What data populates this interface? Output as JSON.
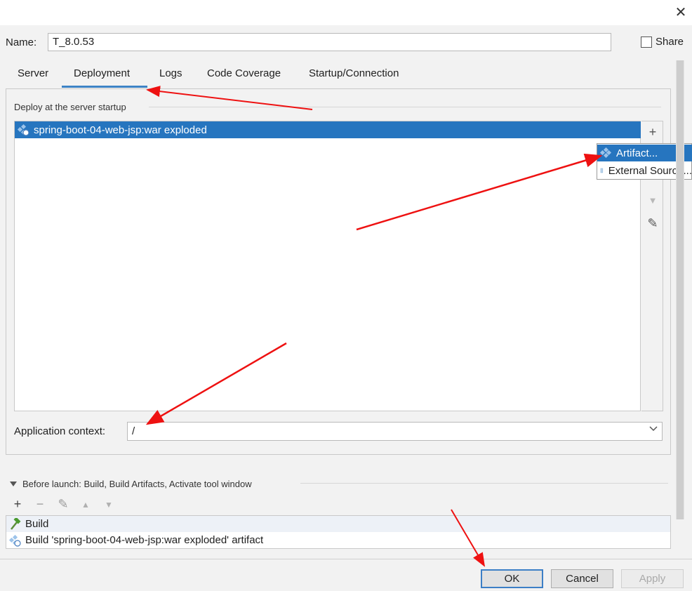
{
  "window": {
    "close_glyph": "✕"
  },
  "name_field": {
    "label": "Name:",
    "value": "T_8.0.53"
  },
  "share": {
    "label": "Share",
    "checked": false
  },
  "tabs": [
    {
      "label": "Server"
    },
    {
      "label": "Deployment",
      "active": true
    },
    {
      "label": "Logs"
    },
    {
      "label": "Code Coverage"
    },
    {
      "label": "Startup/Connection"
    }
  ],
  "deployment": {
    "section_label": "Deploy at the server startup",
    "items": [
      {
        "label": "spring-boot-04-web-jsp:war exploded",
        "icon": "artifact-icon",
        "selected": true
      }
    ],
    "toolbar": {
      "add": "+",
      "remove": "−",
      "down": "▼",
      "edit": "✎"
    },
    "popup_menu": [
      {
        "label": "Artifact...",
        "icon": "artifact-icon",
        "selected": true
      },
      {
        "label": "External Source...",
        "icon": "external-source-icon"
      }
    ],
    "app_context_label": "Application context:",
    "app_context_value": "/"
  },
  "before_launch": {
    "label": "Before launch: Build, Build Artifacts, Activate tool window",
    "toolbar": {
      "add": "+",
      "remove": "−",
      "edit": "✎",
      "up": "▲",
      "down": "▼"
    },
    "items": [
      {
        "label": "Build",
        "icon": "hammer-icon"
      },
      {
        "label": "Build 'spring-boot-04-web-jsp:war exploded' artifact",
        "icon": "artifact-icon"
      }
    ]
  },
  "buttons": {
    "ok": "OK",
    "cancel": "Cancel",
    "apply": "Apply"
  },
  "colors": {
    "selection": "#2675bf",
    "tab_underline": "#3d83c6",
    "annotation_arrow": "#ee1111"
  }
}
